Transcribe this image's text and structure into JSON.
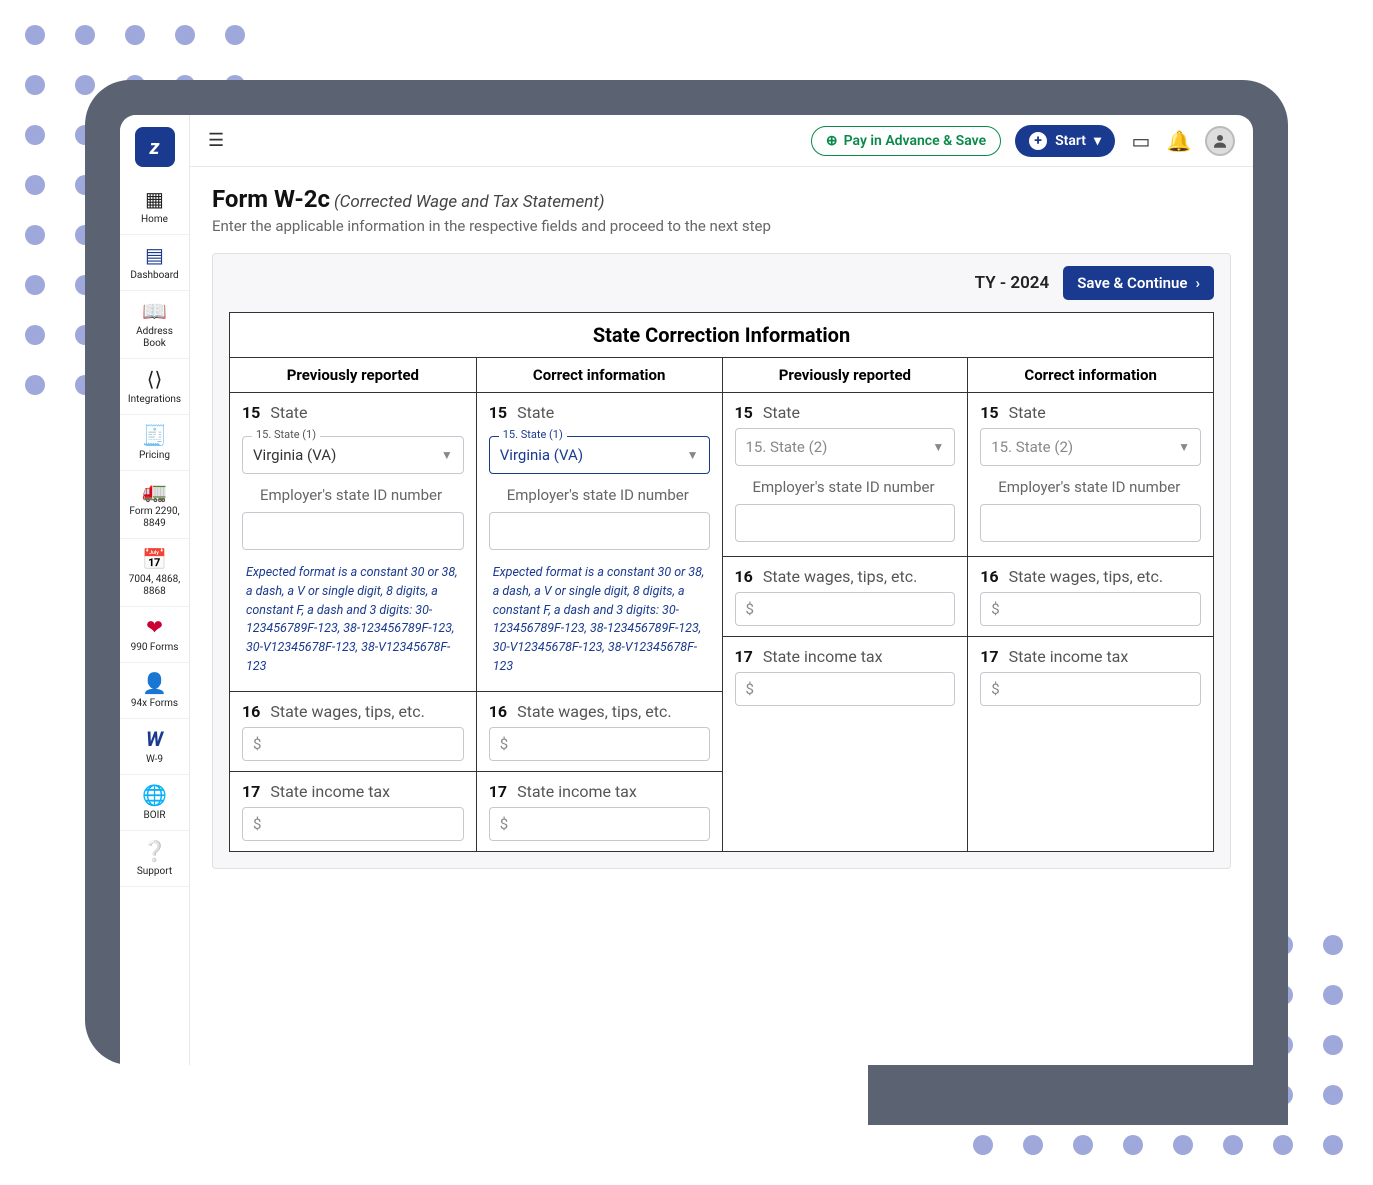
{
  "sidebar": {
    "items": [
      {
        "label": "Home"
      },
      {
        "label": "Dashboard"
      },
      {
        "label": "Address Book"
      },
      {
        "label": "Integrations"
      },
      {
        "label": "Pricing"
      },
      {
        "label": "Form 2290, 8849"
      },
      {
        "label": "7004, 4868, 8868"
      },
      {
        "label": "990 Forms"
      },
      {
        "label": "94x Forms"
      },
      {
        "label": "W-9"
      },
      {
        "label": "BOIR"
      },
      {
        "label": "Support"
      }
    ]
  },
  "topbar": {
    "pay_label": "Pay in Advance & Save",
    "start_label": "Start"
  },
  "page": {
    "title": "Form W-2c",
    "subtitle": "(Corrected Wage and Tax Statement)",
    "description": "Enter the applicable information in the respective fields and proceed to the next step"
  },
  "card": {
    "tax_year": "TY - 2024",
    "save_continue": "Save & Continue"
  },
  "section_title": "State Correction Information",
  "headers": {
    "prev": "Previously reported",
    "corr": "Correct information"
  },
  "rows": {
    "r15_num": "15",
    "r15_label": "State",
    "state1_legend": "15. State (1)",
    "state1_value": "Virginia (VA)",
    "state2_placeholder": "15. State (2)",
    "ein_label": "Employer's state ID number",
    "hint": "Expected format is a constant 30 or 38, a dash, a V or single digit, 8 digits, a constant F, a dash and 3 digits: 30-123456789F-123, 38-123456789F-123, 30-V12345678F-123, 38-V12345678F-123",
    "r16_num": "16",
    "r16_label": "State wages, tips, etc.",
    "r17_num": "17",
    "r17_label": "State income tax",
    "currency": "$"
  }
}
